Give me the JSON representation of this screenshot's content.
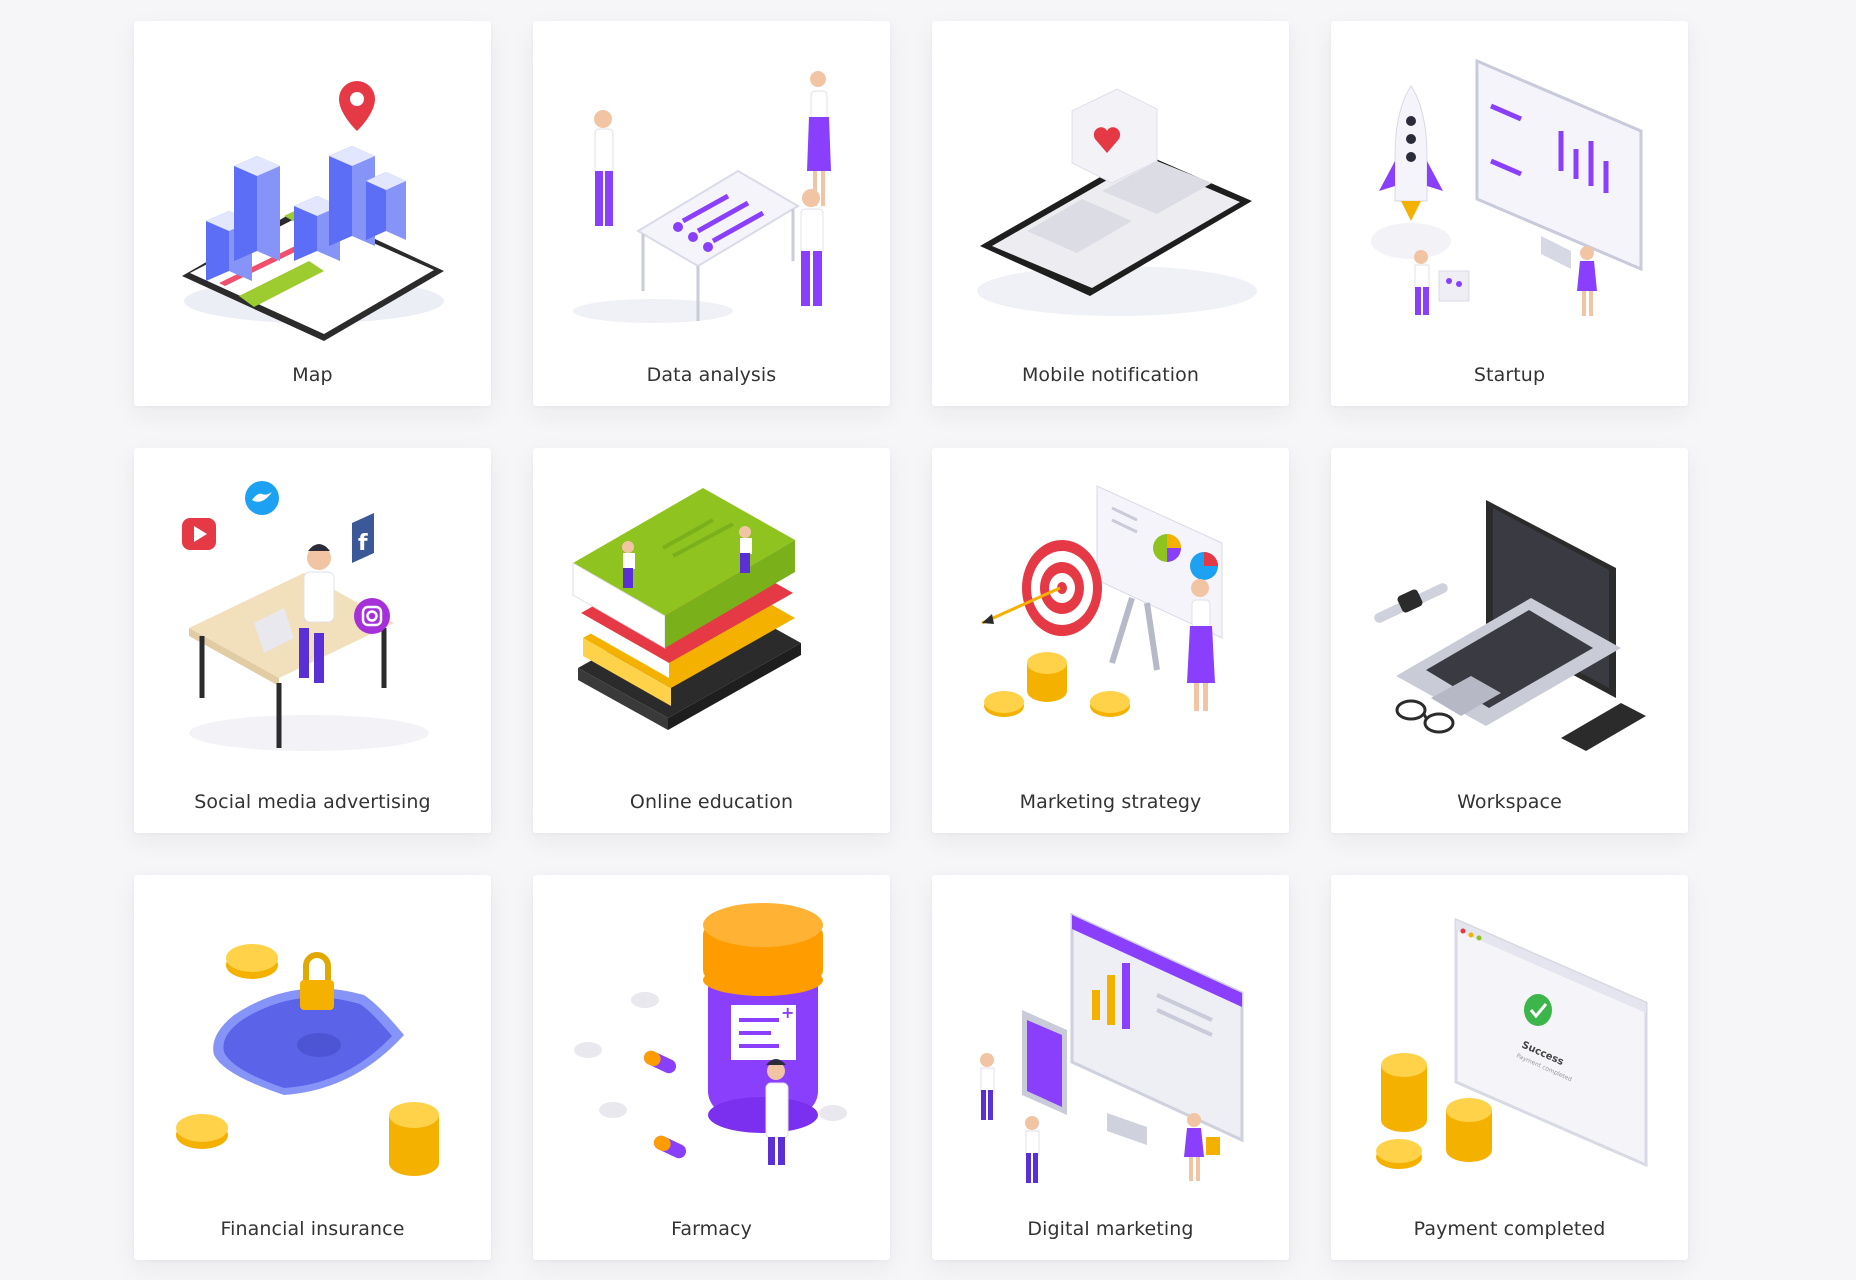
{
  "colors": {
    "background": "#f6f6f8",
    "card": "#ffffff",
    "label": "#333333",
    "accent_purple": "#8a3ffc",
    "accent_blue": "#5b6ef5",
    "accent_green": "#8fc31f",
    "accent_gold": "#f5b100",
    "accent_red": "#e53946"
  },
  "cards": [
    {
      "label": "Map",
      "icon": "city-map-icon"
    },
    {
      "label": "Data analysis",
      "icon": "data-analysis-icon"
    },
    {
      "label": "Mobile notification",
      "icon": "mobile-notification-icon"
    },
    {
      "label": "Startup",
      "icon": "rocket-startup-icon"
    },
    {
      "label": "Social media advertising",
      "icon": "social-media-icon"
    },
    {
      "label": "Online education",
      "icon": "books-education-icon"
    },
    {
      "label": "Marketing strategy",
      "icon": "target-strategy-icon"
    },
    {
      "label": "Workspace",
      "icon": "laptop-workspace-icon"
    },
    {
      "label": "Financial insurance",
      "icon": "shield-insurance-icon"
    },
    {
      "label": "Farmacy",
      "icon": "pill-bottle-icon"
    },
    {
      "label": "Digital marketing",
      "icon": "monitor-marketing-icon"
    },
    {
      "label": "Payment completed",
      "icon": "payment-success-icon"
    }
  ],
  "payment": {
    "success_text": "Success",
    "sub_text": "Payment completed"
  }
}
